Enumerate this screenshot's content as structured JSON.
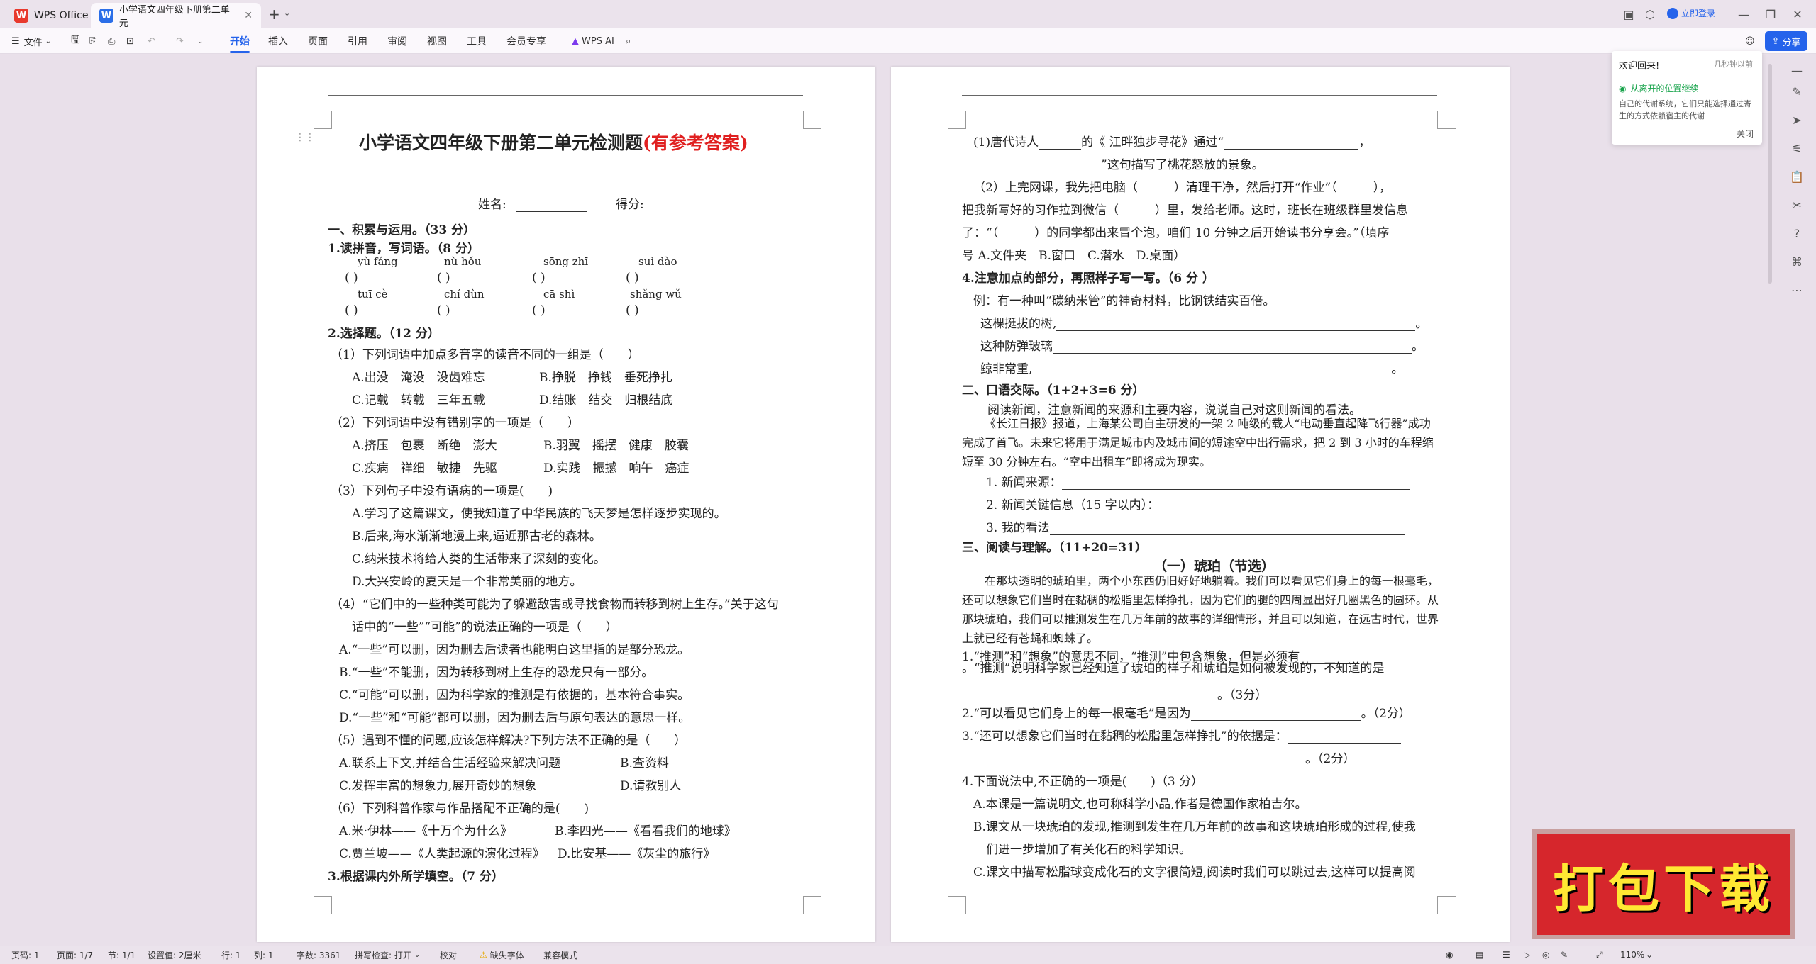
{
  "titlebar": {
    "tabs": [
      {
        "label": "WPS Office",
        "icon": "wps-logo-icon"
      },
      {
        "label": "小学语文四年级下册第二单元",
        "icon": "writer-doc-icon"
      }
    ],
    "login": "立即登录"
  },
  "toolbar": {
    "file": "文件",
    "menus": [
      "开始",
      "插入",
      "页面",
      "引用",
      "审阅",
      "视图",
      "工具",
      "会员专享"
    ],
    "ai": "WPS AI",
    "share": "分享"
  },
  "welcome": {
    "title": "欢迎回来!",
    "time": "几秒钟以前",
    "link": "从离开的位置继续",
    "body": "自己的代谢系统，它们只能选择通过寄生的方式依赖宿主的代谢",
    "close": "关闭"
  },
  "page1": {
    "title": "小学语文四年级下册第二单元检测题",
    "title_red": "(有参考答案)",
    "name_label": "姓名:",
    "score_label": "得分:",
    "sec1": "一、积累与运用。（33 分）",
    "q1": "1.读拼音，写词语。（8 分）",
    "pinyin_row1": [
      "yù  fáng",
      "nù  hǒu",
      "sōng  zhī",
      "suì  dào"
    ],
    "pinyin_row2": [
      "tuī  cè",
      "chí  dùn",
      "cā  shì",
      "shǎng  wǔ"
    ],
    "paren": "(        )",
    "q2": "2.选择题。（12 分）",
    "lines": [
      "（1）下列词语中加点多音字的读音不同的一组是（　　）",
      "A.出没　淹没　没齿难忘",
      "B.挣脱　挣钱　垂死挣扎",
      "C.记载　转载　三年五载",
      "D.结账　结交　归根结底",
      "（2）下列词语中没有错别字的一项是（　　）",
      "A.挤压　包裹　断绝　澎大",
      "B.羽翼　摇摆　健康　胶囊",
      "C.疾病　祥细　敏捷　先驱",
      "D.实践　振撼　响午　癌症",
      "（3）下列句子中没有语病的一项是(　　)",
      "A.学习了这篇课文，使我知道了中华民族的飞天梦是怎样逐步实现的。",
      "B.后来,海水渐渐地漫上来,逼近那古老的森林。",
      "C.纳米技术将给人类的生活带来了深刻的变化。",
      "D.大兴安岭的夏天是一个非常美丽的地方。",
      "（4）“它们中的一些种类可能为了躲避敌害或寻找食物而转移到树上生存。”关于这句",
      "话中的“一些”“可能”的说法正确的一项是（　　）",
      "A.“一些”可以删，因为删去后读者也能明白这里指的是部分恐龙。",
      "B.“一些”不能删，因为转移到树上生存的恐龙只有一部分。",
      "C.“可能”可以删，因为科学家的推测是有依据的，基本符合事实。",
      "D.“一些”和“可能”都可以删，因为删去后与原句表达的意思一样。",
      "（5）遇到不懂的问题,应该怎样解决?下列方法不正确的是（　　）",
      "A.联系上下文,并结合生活经验来解决问题",
      "B.查资料",
      "C.发挥丰富的想象力,展开奇妙的想象",
      "D.请教别人",
      "（6）下列科普作家与作品搭配不正确的是(　　)",
      "A.米·伊林——《十万个为什么》",
      "B.李四光——《看看我们的地球》",
      "C.贾兰坡——《人类起源的演化过程》",
      "D.比安基——《灰尘的旅行》",
      "3.根据课内外所学填空。（7 分）"
    ]
  },
  "page2": {
    "lines": [
      "(1)唐代诗人",
      "的《 江畔独步寻花》通过“",
      "”这句描写了桃花怒放的景象。",
      "（2）上完网课，我先把电脑（　　　）清理干净，然后打开“作业”（　　　），",
      "把我新写好的习作拉到微信（　　　）里，发给老师。这时，班长在班级群里发信息",
      "了：“（　　　）的同学都出来冒个泡，咱们 10 分钟之后开始读书分享会。”（填序",
      "号 A.文件夹　B.窗口　C.潜水　D.桌面）",
      "4.注意加点的部分，再照样子写一写。（6 分 ）",
      "例：有一种叫“碳纳米管”的神奇材料，比钢铁结实百倍。",
      "这棵挺拔的树,",
      "这种防弹玻璃",
      "鲸非常重,",
      "二、口语交际。（1+2+3=6 分）",
      "阅读新闻，注意新闻的来源和主要内容，说说自己对这则新闻的看法。",
      "《长江日报》报道，上海某公司自主研发的一架 2 吨级的载人“电动垂直起降飞行器”成功完成了首飞。未来它将用于满足城市内及城市间的短途空中出行需求，把 2 到 3 小时的车程缩短至 30 分钟左右。“空中出租车”即将成为现实。",
      "1.  新闻来源：",
      "2.  新闻关键信息（15 字以内）：",
      "3.  我的看法",
      "三、阅读与理解。（11+20=31）",
      "（一）琥珀（节选）",
      "在那块透明的琥珀里，两个小东西仍旧好好地躺着。我们可以看见它们身上的每一根毫毛，还可以想象它们当时在黏稠的松脂里怎样挣扎，因为它们的腿的四周显出好几圈黑色的圆环。从那块琥珀，我们可以推测发生在几万年前的故事的详细情形，并且可以知道，在远古时代，世界上就已经有苍蝇和蜘蛛了。",
      "1.“推测”和“想象”的意思不同，“推测”中包含想象，但是必须有",
      "。“推测”说明科学家已经知道了琥珀的样子和琥珀是如何被发现的，不知道的是",
      "。（3分）",
      "2.“可以看见它们身上的每一根毫毛”是因为",
      "。（2分）",
      "3.“还可以想象它们当时在黏稠的松脂里怎样挣扎”的依据是：",
      "。（2分）",
      "4.下面说法中,不正确的一项是(　　)（3 分）",
      "A.本课是一篇说明文,也可称科学小品,作者是德国作家柏吉尔。",
      "B.课文从一块琥珀的发现,推测到发生在几万年前的故事和这块琥珀形成的过程,使我",
      "们进一步增加了有关化石的科学知识。",
      "C.课文中描写松脂球变成化石的文字很简短,阅读时我们可以跳过去,这样可以提高阅"
    ]
  },
  "statusbar": {
    "items": [
      "页码: 1",
      "页面: 1/7",
      "节: 1/1",
      "设置值: 2厘米",
      "行: 1",
      "列: 1",
      "字数: 3361",
      "拼写检查: 打开",
      "校对",
      "缺失字体",
      "兼容模式"
    ],
    "zoom": "110%"
  },
  "ad": {
    "text": "打包下载"
  },
  "colors": {
    "accent": "#2563eb",
    "title_red": "#e02020",
    "ad_red": "#d6262c",
    "ad_text": "#ffe833"
  }
}
